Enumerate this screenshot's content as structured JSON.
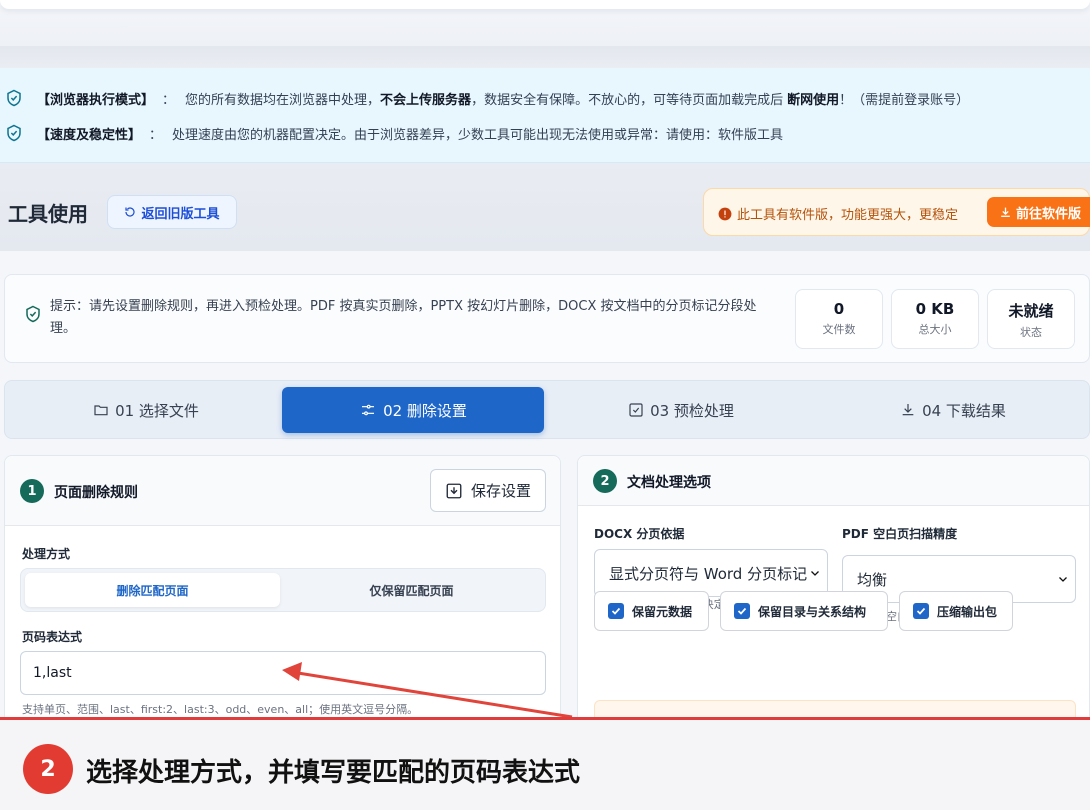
{
  "notice": {
    "line1": {
      "tag": "【浏览器执行模式】",
      "sep": "：",
      "t1": "您的所有数据均在浏览器中处理，",
      "b1": "不会上传服务器",
      "t2": "，数据安全有保障。不放心的，可等待页面加载完成后",
      "b2": "断网使用",
      "t3": "！（需提前登录账号）"
    },
    "line2": {
      "tag": "【速度及稳定性】",
      "sep": "：",
      "text": "处理速度由您的机器配置决定。由于浏览器差异，少数工具可能出现无法使用或异常：请使用：软件版工具"
    }
  },
  "tool": {
    "title": "工具使用",
    "back_label": "返回旧版工具",
    "banner_text": "此工具有软件版，功能更强大，更稳定",
    "banner_button": "前往软件版"
  },
  "tip": {
    "text": "提示：请先设置删除规则，再进入预检处理。PDF 按真实页删除，PPTX 按幻灯片删除，DOCX 按文档中的分页标记分段处理。",
    "stats": [
      {
        "value": "0",
        "label": "文件数"
      },
      {
        "value": "0 KB",
        "label": "总大小"
      },
      {
        "value": "未就绪",
        "label": "状态"
      }
    ]
  },
  "steps": [
    {
      "label": "01 选择文件",
      "icon": "folder-icon"
    },
    {
      "label": "02 删除设置",
      "icon": "sliders-icon"
    },
    {
      "label": "03 预检处理",
      "icon": "check-square-icon"
    },
    {
      "label": "04 下载结果",
      "icon": "download-icon"
    }
  ],
  "panel_left": {
    "number": "1",
    "title": "页面删除规则",
    "save_label": "保存设置",
    "mode_label": "处理方式",
    "modes": [
      "删除匹配页面",
      "仅保留匹配页面"
    ],
    "selected_mode": "删除匹配页面",
    "expr_label": "页码表达式",
    "expr_value": "1,last",
    "expr_hint": "支持单页、范围、last、first:2、last:3、odd、even、all；使用英文逗号分隔。"
  },
  "panel_right": {
    "number": "2",
    "title": "文档处理选项",
    "docx_label": "DOCX 分页依据",
    "docx_value": "显式分页符与 Word 分页标记",
    "docx_hint": "Word 页面由排版引擎决定，网页端会依据文档内已有分页标记处理。",
    "pdf_label": "PDF 空白页扫描精度",
    "pdf_value": "均衡",
    "pdf_hint": "仅在启用空白页检测时使用。",
    "checkboxes": [
      {
        "label": "保留元数据",
        "checked": true
      },
      {
        "label": "保留目录与关系结构",
        "checked": true
      },
      {
        "label": "压缩输出包",
        "checked": true
      }
    ]
  },
  "annotation": {
    "step_number": "2",
    "caption": "选择处理方式，并填写要匹配的页码表达式",
    "color": "#e23b32"
  }
}
